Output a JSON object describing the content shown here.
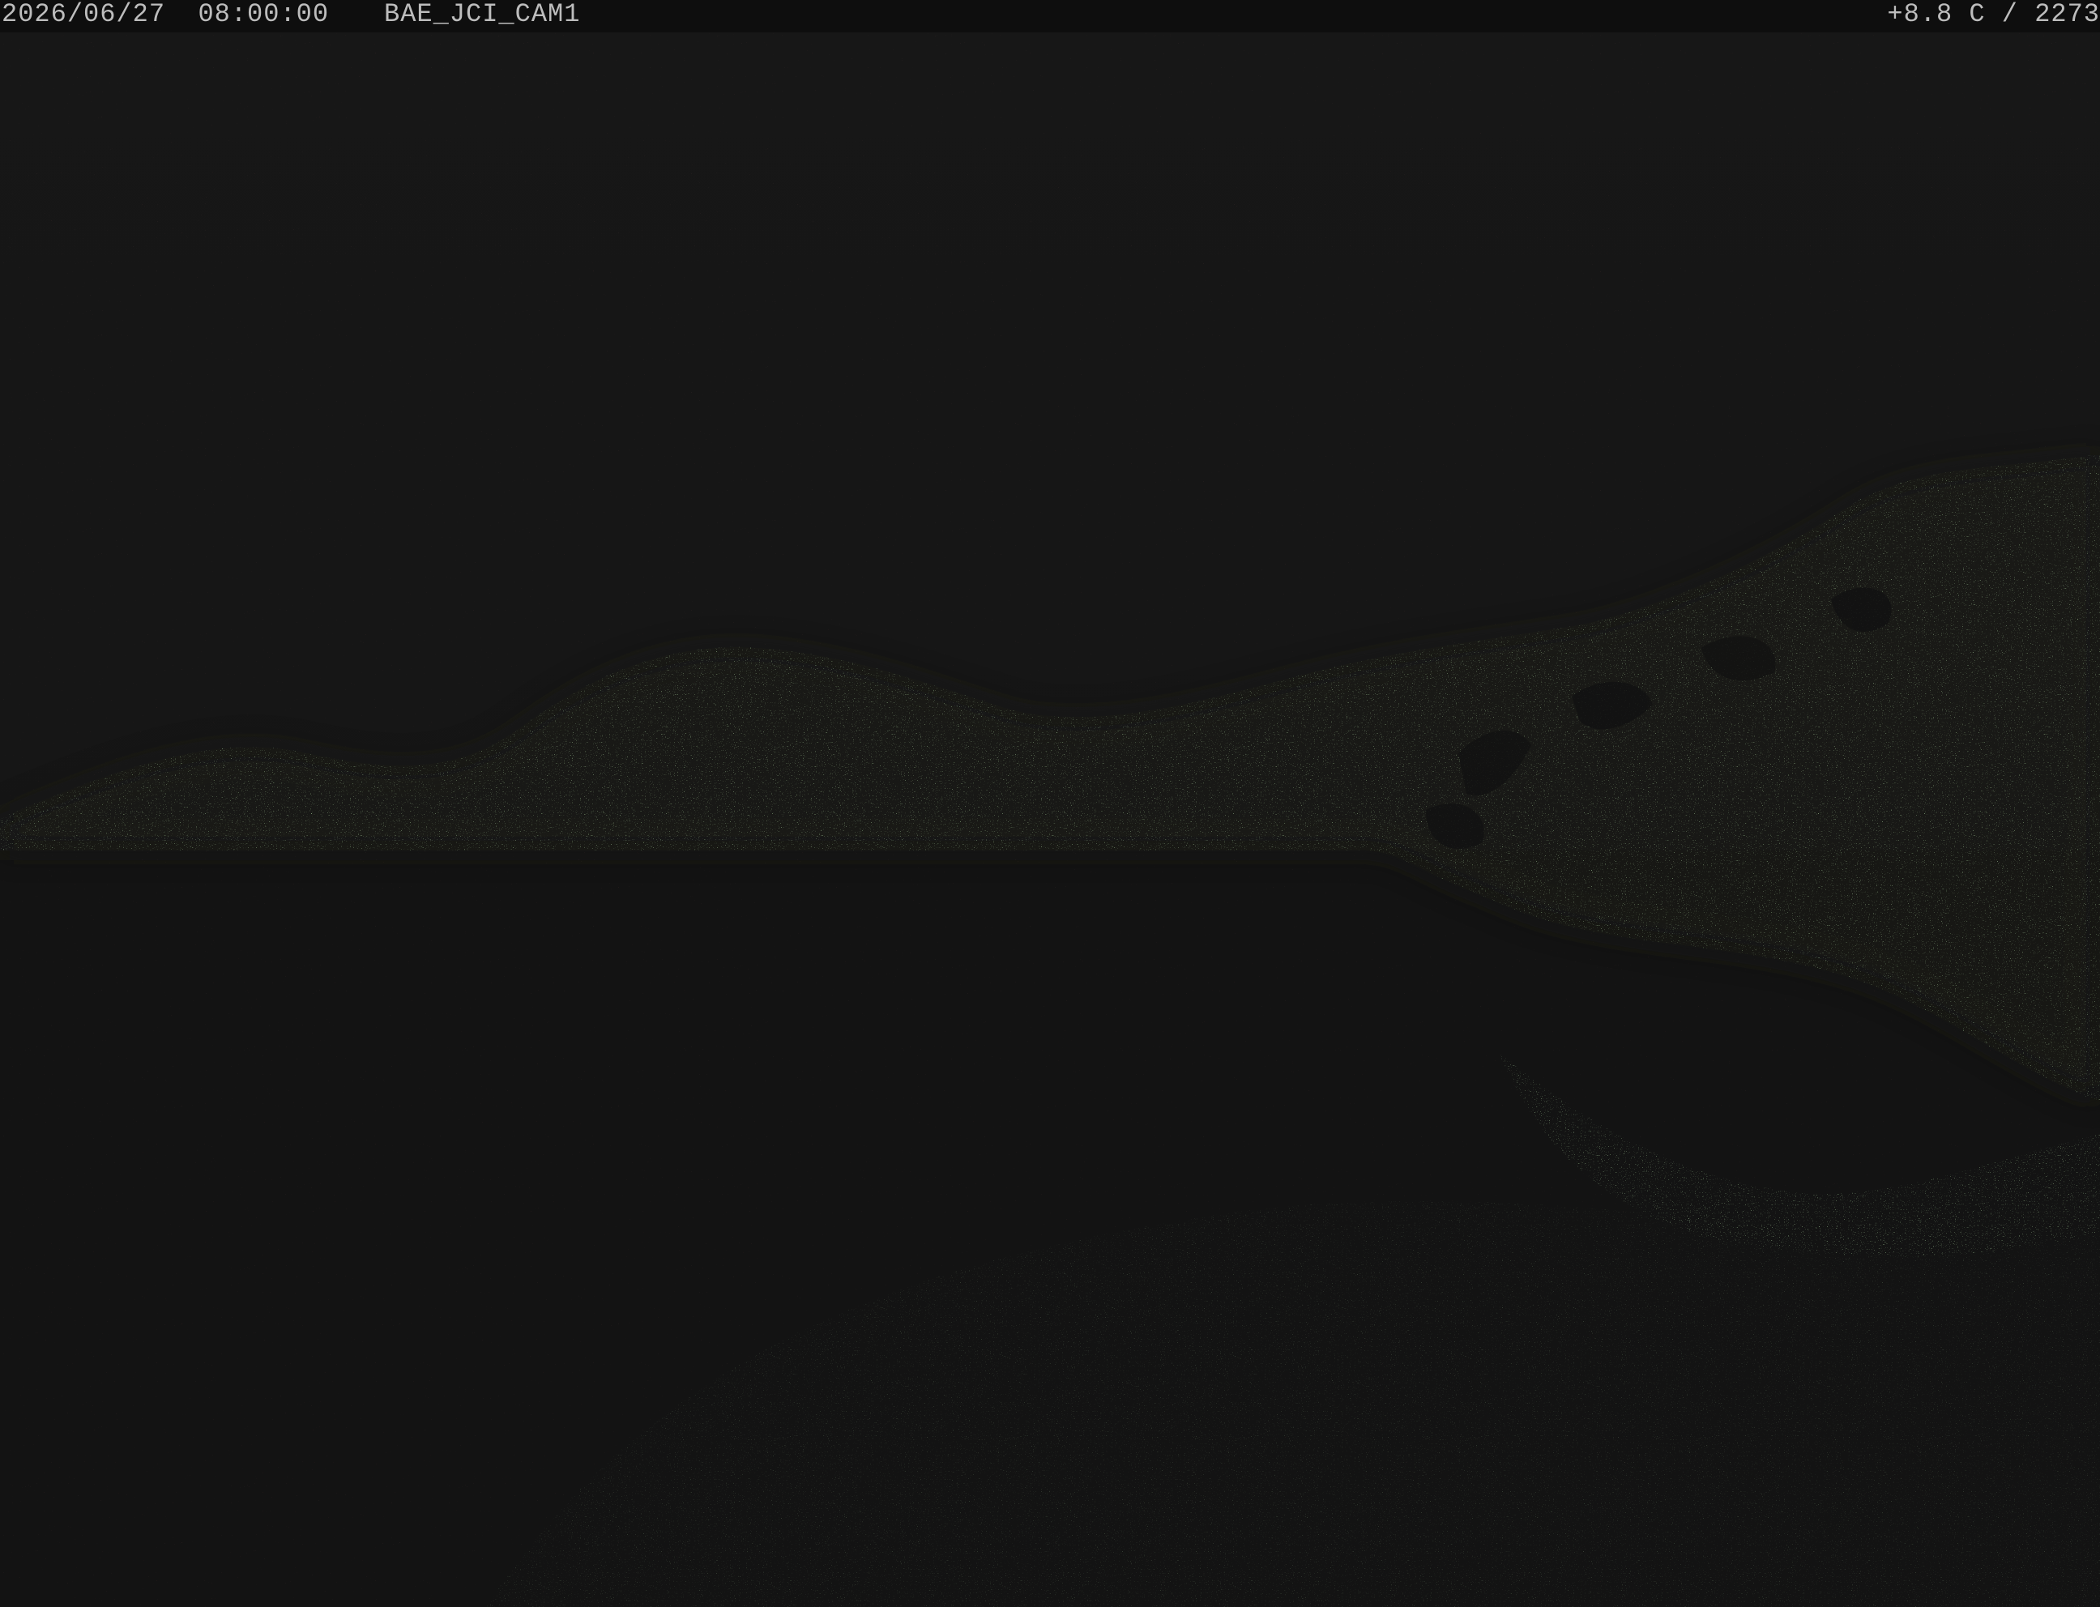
{
  "overlay": {
    "datetime": "2026/06/27  08:00:00",
    "camera_id": "BAE_JCI_CAM1",
    "reading": "+8.8 C / 2273"
  },
  "scene": {
    "description_colors": {
      "sky": "#161616",
      "ground": "#131313",
      "glacier_highlight": "#3a4a2a",
      "noise_red": "#7a2a2a",
      "noise_green": "#3f6a3a",
      "noise_blue": "#2a3a7a"
    }
  }
}
